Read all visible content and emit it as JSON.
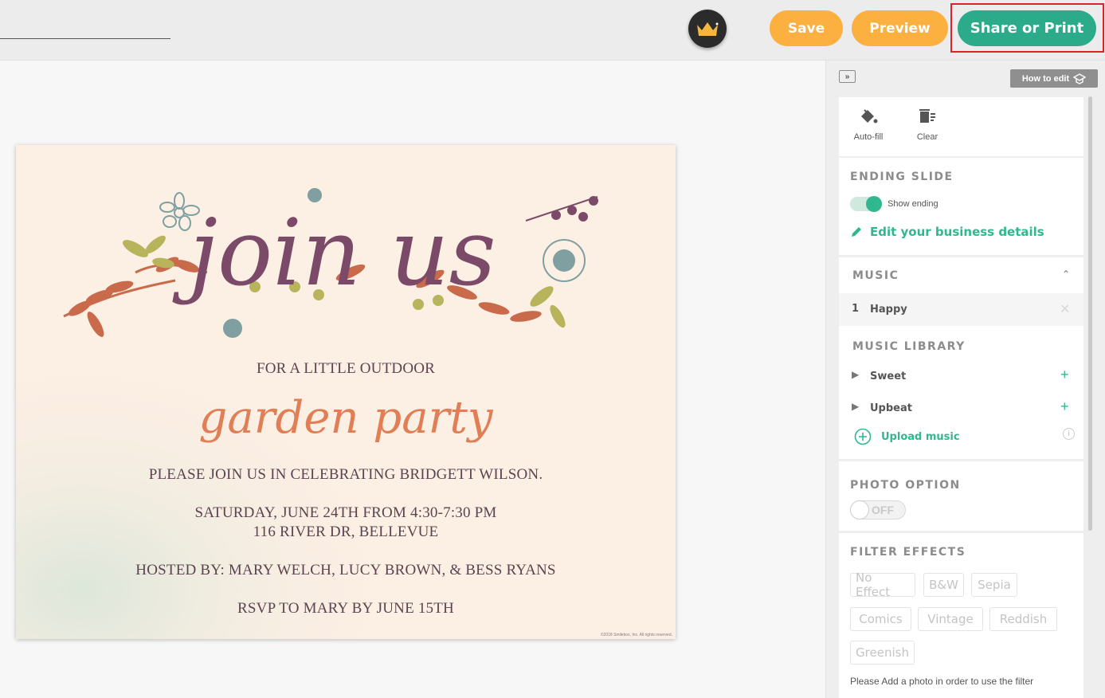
{
  "toolbar": {
    "save_label": "Save",
    "preview_label": "Preview",
    "share_label": "Share or Print"
  },
  "card": {
    "headline": "join us",
    "line1": "FOR A LITTLE OUTDOOR",
    "script": "garden party",
    "line2": "PLEASE JOIN US IN CELEBRATING BRIDGETT WILSON.",
    "line3": "SATURDAY, JUNE 24TH FROM 4:30-7:30 PM",
    "line4": "116 RIVER DR, BELLEVUE",
    "line5": "HOSTED BY: MARY WELCH, LUCY BROWN, & BESS RYANS",
    "line6": "RSVP TO MARY BY JUNE 15TH",
    "copyright": "©2018 Smilebox, Inc. All rights reserved."
  },
  "panel": {
    "how_to_edit": "How to edit",
    "tools": {
      "autofill": "Auto-fill",
      "clear": "Clear"
    },
    "ending": {
      "title": "ENDING SLIDE",
      "show_ending": "Show ending",
      "edit_business": "Edit your business details"
    },
    "music": {
      "title": "MUSIC",
      "selected_index": "1",
      "selected_track": "Happy",
      "library_title": "MUSIC LIBRARY",
      "library": [
        "Sweet",
        "Upbeat"
      ],
      "upload": "Upload music"
    },
    "photo": {
      "title": "PHOTO OPTION",
      "toggle": "OFF"
    },
    "filters": {
      "title": "FILTER EFFECTS",
      "options": [
        "No Effect",
        "B&W",
        "Sepia",
        "Comics",
        "Vintage",
        "Reddish",
        "Greenish"
      ],
      "note": "Please Add a photo in order to use the filter"
    }
  },
  "colors": {
    "accent_orange": "#fbb040",
    "accent_green": "#2bab8a",
    "highlight_red": "#e0202a",
    "headline_purple": "#7b4a68",
    "script_orange": "#e07f55"
  }
}
